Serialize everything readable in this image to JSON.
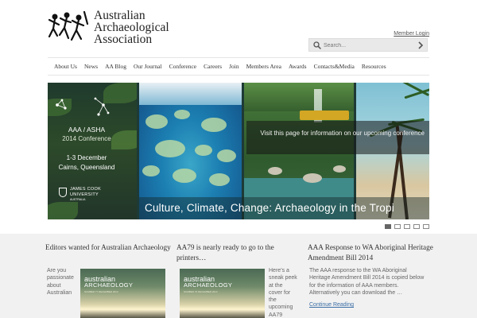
{
  "header": {
    "logo": {
      "line1": "Australian",
      "line2": "Archaeological",
      "line3": "Association"
    },
    "member_login": "Member Login",
    "search": {
      "placeholder": "Search..."
    }
  },
  "nav": {
    "items": [
      "About Us",
      "News",
      "AA Blog",
      "Our Journal",
      "Conference",
      "Careers",
      "Join",
      "Members Area",
      "Awards",
      "Contacts&Media",
      "Resources"
    ]
  },
  "slider": {
    "conference": {
      "title": "AAA / ASHA",
      "subtitle": "2014 Conference",
      "dates": "1-3 December",
      "place": "Cairns, Queensland",
      "university_line1": "JAMES COOK",
      "university_line2": "UNIVERSITY",
      "university_line3": "AUSTRALIA"
    },
    "overlay_text": "Visit this page for information on our upcoming conference",
    "caption": "Culture, Climate, Change: Archaeology in the Tropi",
    "slide_count": 5,
    "active_slide": 1
  },
  "articles": [
    {
      "title": "Editors wanted for Australian Archaeology",
      "excerpt_lines": [
        "Are you",
        "passionate",
        "about",
        "Australian"
      ],
      "thumb": {
        "line1": "australian",
        "line2": "ARCHAEOLOGY",
        "line3": "NUMBER 77 DECEMBER 2013"
      }
    },
    {
      "title": "AA79 is nearly ready to go to the printers…",
      "excerpt_lines": [
        "Here’s a",
        "sneak peek",
        "at the",
        "cover for",
        "the",
        "upcoming",
        "AA79"
      ],
      "thumb": {
        "line1": "australian",
        "line2": "ARCHAEOLOGY",
        "line3": "NUMBER 79 DECEMBER 2014"
      }
    },
    {
      "title": "AAA Response to WA Aboriginal Heritage Amendment Bill 2014",
      "excerpt_lines": [
        "The AAA response to the WA Aboriginal",
        "Heritage Amendment Bill 2014 is copied below",
        "for the information of AAA members.",
        "Alternatively you can download the …"
      ],
      "continue_label": "Continue Reading"
    }
  ],
  "colors": {
    "link": "#3a6ea5",
    "article_band": "#f1f1f1"
  }
}
